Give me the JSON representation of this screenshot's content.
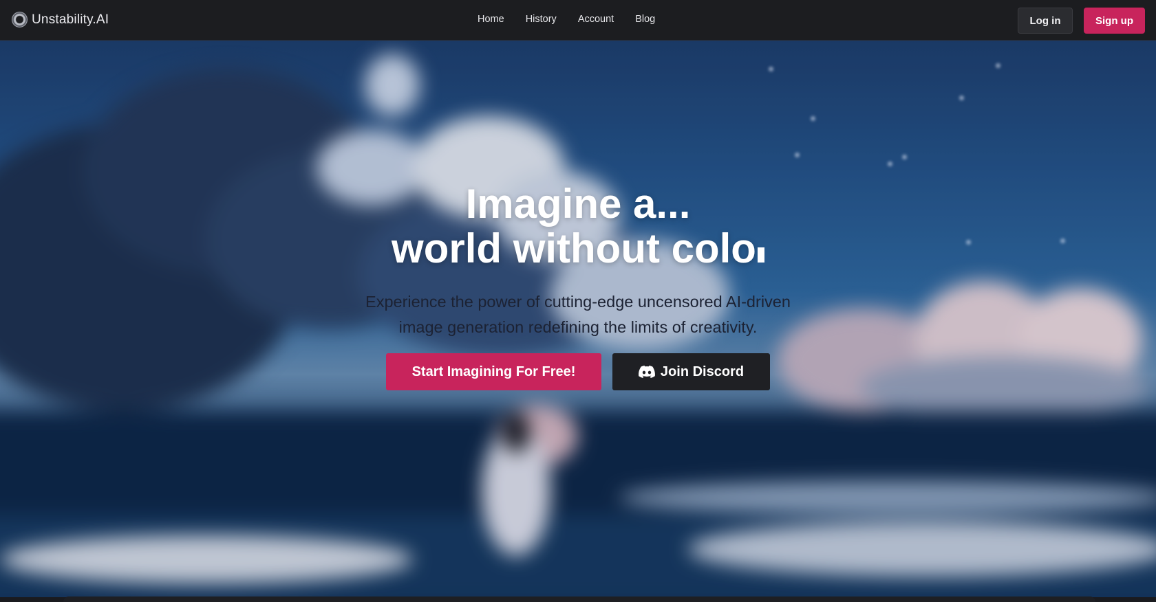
{
  "brand": {
    "name": "Unstability.AI",
    "logo_icon": "aperture-logo-icon"
  },
  "nav": {
    "links": [
      {
        "label": "Home"
      },
      {
        "label": "History"
      },
      {
        "label": "Account"
      },
      {
        "label": "Blog"
      }
    ],
    "login_label": "Log in",
    "signup_label": "Sign up"
  },
  "hero": {
    "headline_line1": "Imagine a...",
    "headline_line2": "world without colo",
    "subtitle_line1": "Experience the power of cutting-edge uncensored AI-driven",
    "subtitle_line2": "image generation redefining the limits of creativity.",
    "primary_cta": "Start Imagining For Free!",
    "discord_cta": "Join Discord",
    "discord_icon": "discord-icon"
  },
  "colors": {
    "accent": "#c8245c",
    "nav_bg": "#1c1d20",
    "dark_button": "#1f2024"
  }
}
